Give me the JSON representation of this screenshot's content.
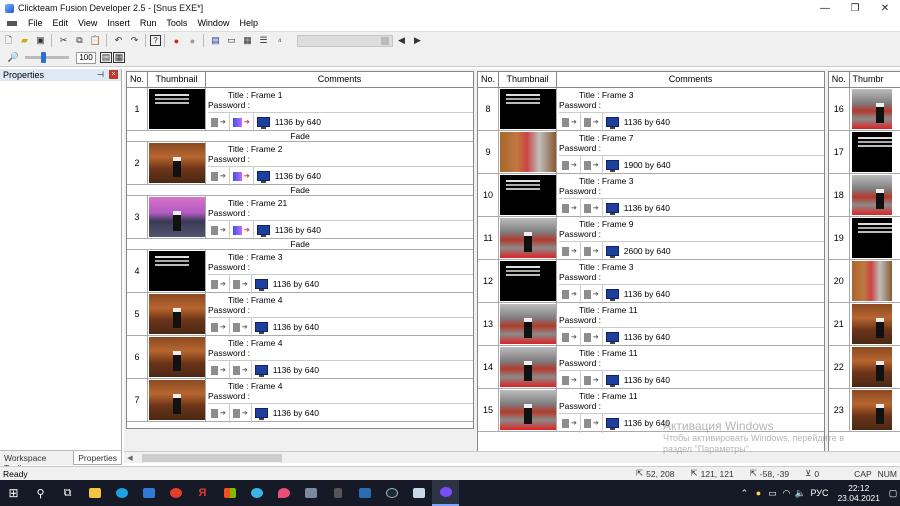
{
  "window": {
    "title": "Clickteam Fusion Developer 2.5 - [Snus EXE*]"
  },
  "menu": [
    "File",
    "Edit",
    "View",
    "Insert",
    "Run",
    "Tools",
    "Window",
    "Help"
  ],
  "toolbar2": {
    "zoom_value": "100"
  },
  "properties": {
    "title": "Properties",
    "pin": "ᵖ"
  },
  "bottom_tabs": [
    "Workspace Toolbar",
    "Properties"
  ],
  "table": {
    "headers": [
      "No.",
      "Thumbnail",
      "Comments"
    ]
  },
  "labels": {
    "title_prefix": "Title : ",
    "password": "Password :",
    "by": "by"
  },
  "transition_label": "Fade",
  "frames_col1": [
    {
      "no": "1",
      "title": "Frame 1",
      "thumb": "black",
      "res_w": "1136",
      "res_h": "640",
      "colored": true,
      "transition": true
    },
    {
      "no": "2",
      "title": "Frame 2",
      "thumb": "brown",
      "res_w": "1136",
      "res_h": "640",
      "colored": true,
      "transition": true
    },
    {
      "no": "3",
      "title": "Frame 21",
      "thumb": "pink",
      "res_w": "1136",
      "res_h": "640",
      "colored": true,
      "transition": true
    },
    {
      "no": "4",
      "title": "Frame 3",
      "thumb": "black",
      "res_w": "1136",
      "res_h": "640",
      "colored": false,
      "transition": false
    },
    {
      "no": "5",
      "title": "Frame 4",
      "thumb": "brown",
      "res_w": "1136",
      "res_h": "640",
      "colored": false,
      "transition": false
    },
    {
      "no": "6",
      "title": "Frame 4",
      "thumb": "brown",
      "res_w": "1136",
      "res_h": "640",
      "colored": false,
      "transition": false
    },
    {
      "no": "7",
      "title": "Frame 4",
      "thumb": "brown",
      "res_w": "1136",
      "res_h": "640",
      "colored": false,
      "transition": false
    }
  ],
  "frames_col2": [
    {
      "no": "8",
      "title": "Frame 3",
      "thumb": "black",
      "res_w": "1136",
      "res_h": "640"
    },
    {
      "no": "9",
      "title": "Frame 7",
      "thumb": "wood",
      "res_w": "1900",
      "res_h": "640"
    },
    {
      "no": "10",
      "title": "Frame 3",
      "thumb": "black",
      "res_w": "1136",
      "res_h": "640"
    },
    {
      "no": "11",
      "title": "Frame 9",
      "thumb": "store",
      "res_w": "2600",
      "res_h": "640"
    },
    {
      "no": "12",
      "title": "Frame 3",
      "thumb": "black",
      "res_w": "1136",
      "res_h": "640"
    },
    {
      "no": "13",
      "title": "Frame 11",
      "thumb": "store",
      "res_w": "1136",
      "res_h": "640"
    },
    {
      "no": "14",
      "title": "Frame 11",
      "thumb": "store",
      "res_w": "1136",
      "res_h": "640"
    },
    {
      "no": "15",
      "title": "Frame 11",
      "thumb": "store",
      "res_w": "1136",
      "res_h": "640"
    }
  ],
  "frames_col3": [
    {
      "no": "16",
      "thumb": "store"
    },
    {
      "no": "17",
      "thumb": "black"
    },
    {
      "no": "18",
      "thumb": "store"
    },
    {
      "no": "19",
      "thumb": "black"
    },
    {
      "no": "20",
      "thumb": "wood"
    },
    {
      "no": "21",
      "thumb": "brown"
    },
    {
      "no": "22",
      "thumb": "brown"
    },
    {
      "no": "23",
      "thumb": "brown"
    }
  ],
  "col3_header": "Thumbr",
  "status": {
    "ready": "Ready",
    "pos1": "52, 208",
    "pos2": "121, 121",
    "pos3": "-58, -39",
    "count": "0",
    "cap": "CAP",
    "num": "NUM"
  },
  "watermark": {
    "line1": "Активация Windows",
    "line2": "Чтобы активировать Windows, перейдите в",
    "line3": "раздел \"Параметры\"."
  },
  "taskbar": {
    "lang": "РУС",
    "time": "22:12",
    "date": "23.04.2021"
  }
}
